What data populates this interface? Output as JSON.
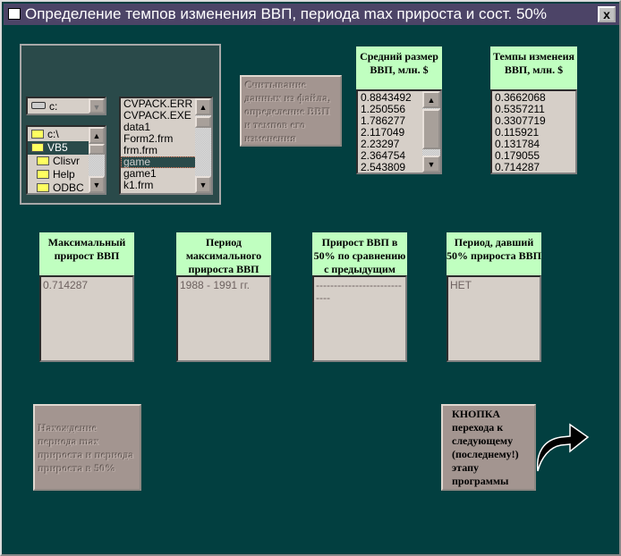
{
  "window": {
    "title": "Определение темпов изменения ВВП, периода max прироста и сост. 50%",
    "close": "x"
  },
  "drive": {
    "value": "c:"
  },
  "dirs": [
    {
      "label": "c:\\",
      "open": true
    },
    {
      "label": "VB5",
      "open": true,
      "selected": true
    },
    {
      "label": "Clisvr"
    },
    {
      "label": "Help"
    },
    {
      "label": "ODBC"
    }
  ],
  "files": [
    "CVPACK.ERR",
    "CVPACK.EXE",
    "data1",
    "Form2.frm",
    "frm.frm",
    "game",
    "game1",
    "k1.frm"
  ],
  "selected_file": "game",
  "read_button": "Считывание данных из файла, определение ВВП и темпов его изменения",
  "avg": {
    "header": "Средний размер ВВП, млн. $",
    "values": [
      "0.8843492",
      "1.250556",
      "1.786277",
      "2.117049",
      "2.23297",
      "2.364754",
      "2.543809"
    ]
  },
  "rates": {
    "header": "Темпы изменеия ВВП, млн. $",
    "values": [
      "0.3662068",
      "0.5357211",
      "0.3307719",
      "0.115921",
      "0.131784",
      "0.179055",
      "0.714287"
    ]
  },
  "results": [
    {
      "header": "Максимальный прирост ВВП",
      "value": "0.714287"
    },
    {
      "header": "Период максимального прироста ВВП",
      "value": "1988 - 1991 гг."
    },
    {
      "header": "Прирост ВВП в 50% по сравнению с предыдущим",
      "value": "----------------------------"
    },
    {
      "header": "Период, давший 50% прироста ВВП",
      "value": "НЕТ"
    }
  ],
  "find_button": "Нахождение периода max прироста и периода прироста в 50%",
  "next_button": "КНОПКА перехода к следующему (последнему!) этапу программы",
  "colors": {
    "background": "#023f40",
    "header": "#c0ffc0",
    "button": "#a39590"
  }
}
